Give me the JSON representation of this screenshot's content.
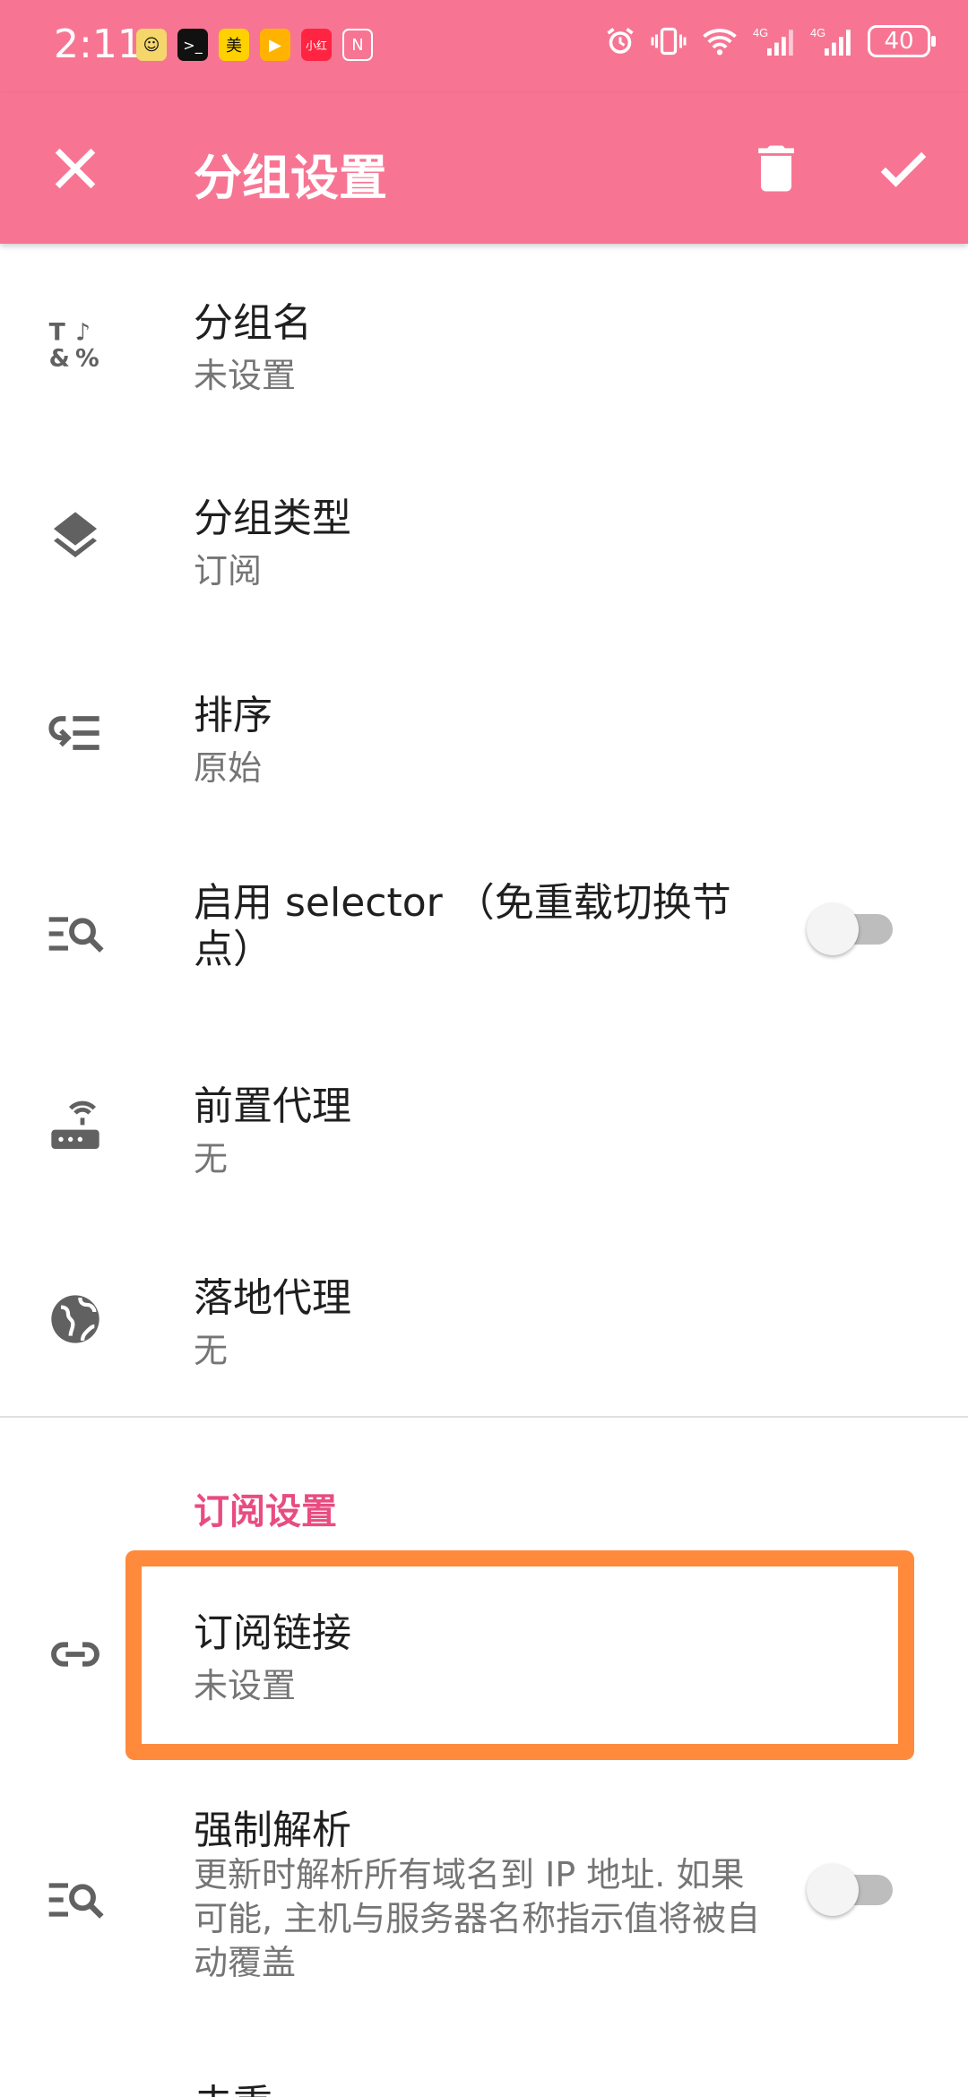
{
  "status_bar": {
    "time": "2:11",
    "apps": [
      {
        "icon": "sticker-app-icon",
        "color": "#f5d66b",
        "glyph": ""
      },
      {
        "icon": "terminal-app-icon",
        "color": "#111111",
        "glyph": ">_"
      },
      {
        "icon": "meituan-app-icon",
        "color": "#ffd100",
        "glyph": "美"
      },
      {
        "icon": "video-app-icon",
        "color": "#ffb300",
        "glyph": "▶"
      },
      {
        "icon": "xiaohongshu-app-icon",
        "color": "#ff2442",
        "glyph": ""
      },
      {
        "icon": "nfc-icon",
        "color": "#ffffff",
        "glyph": ""
      }
    ],
    "battery": "40"
  },
  "toolbar": {
    "title": "分组设置"
  },
  "items": [
    {
      "title": "分组名",
      "subtitle": "未设置",
      "icon": "text-format-icon"
    },
    {
      "title": "分组类型",
      "subtitle": "订阅",
      "icon": "layers-icon"
    },
    {
      "title": "排序",
      "subtitle": "原始",
      "icon": "sort-icon"
    },
    {
      "title": "启用 selector （免重载切换节点）",
      "icon": "search-list-icon",
      "switch_on": false
    },
    {
      "title": "前置代理",
      "subtitle": "无",
      "icon": "router-icon"
    },
    {
      "title": "落地代理",
      "subtitle": "无",
      "icon": "globe-icon"
    }
  ],
  "subscription_section": {
    "header": "订阅设置",
    "items": [
      {
        "title": "订阅链接",
        "subtitle": "未设置",
        "icon": "link-icon"
      },
      {
        "title": "强制解析",
        "subtitle": "更新时解析所有域名到 IP 地址. 如果可能, 主机与服务器名称指示值将被自动覆盖",
        "icon": "search-list-icon",
        "switch_on": false
      },
      {
        "title": "去重"
      }
    ]
  },
  "colors": {
    "primary": "#f77593",
    "accent": "#e84c80",
    "highlight_box": "#ff8a3c",
    "icon_gray": "#616161"
  }
}
